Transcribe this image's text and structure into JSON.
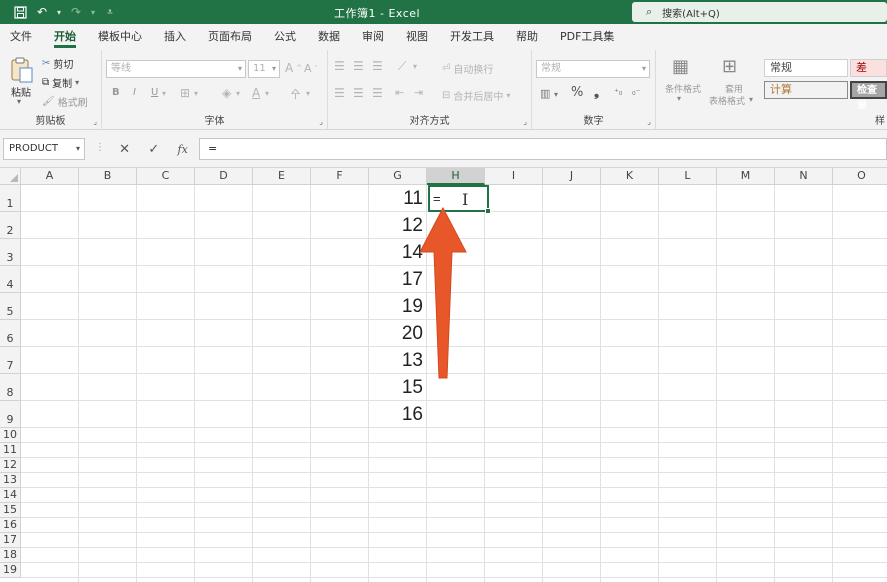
{
  "window": {
    "title": "工作簿1 - Excel"
  },
  "search": {
    "placeholder": "搜索(Alt+Q)"
  },
  "tabs": [
    {
      "label": "文件",
      "active": false
    },
    {
      "label": "开始",
      "active": true
    },
    {
      "label": "模板中心",
      "active": false
    },
    {
      "label": "插入",
      "active": false
    },
    {
      "label": "页面布局",
      "active": false
    },
    {
      "label": "公式",
      "active": false
    },
    {
      "label": "数据",
      "active": false
    },
    {
      "label": "审阅",
      "active": false
    },
    {
      "label": "视图",
      "active": false
    },
    {
      "label": "开发工具",
      "active": false
    },
    {
      "label": "帮助",
      "active": false
    },
    {
      "label": "PDF工具集",
      "active": false
    }
  ],
  "ribbon": {
    "clipboard": {
      "paste": "粘贴",
      "cut": "剪切",
      "copy": "复制",
      "format_painter": "格式刷",
      "label": "剪贴板"
    },
    "font": {
      "font_name": "等线",
      "font_size": "11",
      "bold": "B",
      "italic": "I",
      "underline": "U",
      "label": "字体"
    },
    "alignment": {
      "wrap_text": "自动换行",
      "merge_center": "合并后居中",
      "label": "对齐方式"
    },
    "number": {
      "format": "常规",
      "label": "数字"
    },
    "styles": {
      "conditional_format": "条件格式",
      "table_format_line1": "套用",
      "table_format_line2": "表格格式",
      "style_normal": "常规",
      "style_bad": "差",
      "style_calc": "计算",
      "style_check": "检查单",
      "label_partial": "样"
    }
  },
  "formula_bar": {
    "name_box": "PRODUCT",
    "fx": "fx",
    "formula": "="
  },
  "sheet": {
    "columns": [
      "A",
      "B",
      "C",
      "D",
      "E",
      "F",
      "G",
      "H",
      "I",
      "J",
      "K",
      "L",
      "M",
      "N",
      "O"
    ],
    "rows": [
      "1",
      "2",
      "3",
      "4",
      "5",
      "6",
      "7",
      "8",
      "9",
      "10",
      "11",
      "12",
      "13",
      "14",
      "15",
      "16",
      "17",
      "18",
      "19"
    ],
    "g_values": [
      "11",
      "12",
      "14",
      "17",
      "19",
      "20",
      "13",
      "15",
      "16"
    ],
    "active_cell": {
      "ref": "H1",
      "text": "="
    }
  },
  "colors": {
    "excel_green": "#217346",
    "arrow": "#e8572a"
  }
}
